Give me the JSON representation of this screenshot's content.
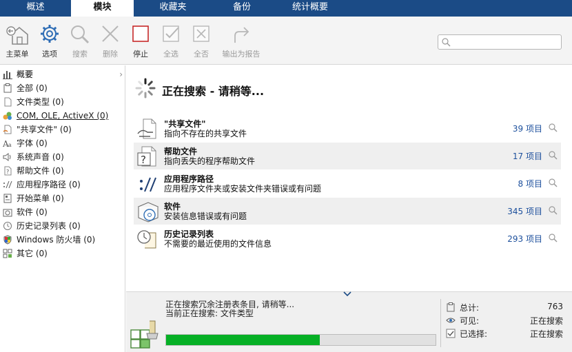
{
  "tabs": [
    {
      "label": "概述",
      "active": false
    },
    {
      "label": "模块",
      "active": true
    },
    {
      "label": "收藏夹",
      "active": false
    },
    {
      "label": "备份",
      "active": false
    },
    {
      "label": "统计概要",
      "active": false
    }
  ],
  "toolbar": {
    "buttons": [
      {
        "label": "主菜单",
        "icon": "home-back-icon",
        "enabled": true
      },
      {
        "label": "选项",
        "icon": "gear-icon",
        "enabled": true
      },
      {
        "label": "搜索",
        "icon": "magnifier-icon",
        "enabled": false
      },
      {
        "label": "删除",
        "icon": "delete-x-icon",
        "enabled": false
      },
      {
        "label": "停止",
        "icon": "stop-square-icon",
        "enabled": true
      },
      {
        "label": "全选",
        "icon": "check-all-icon",
        "enabled": false
      },
      {
        "label": "全否",
        "icon": "uncheck-all-icon",
        "enabled": false
      },
      {
        "label": "输出为报告",
        "icon": "export-report-icon",
        "enabled": false
      }
    ],
    "search_placeholder": "",
    "search_value": ""
  },
  "sidebar": {
    "items": [
      {
        "label": "概要",
        "icon": "bar-chart-icon",
        "selected": true
      },
      {
        "label": "全部 (0)",
        "icon": "clipboard-icon"
      },
      {
        "label": "文件类型 (0)",
        "icon": "file-types-icon"
      },
      {
        "label": "COM, OLE, ActiveX (0)",
        "icon": "com-cubes-icon",
        "underline": true
      },
      {
        "label": "\"共享文件\" (0)",
        "icon": "shared-file-icon"
      },
      {
        "label": "字体 (0)",
        "icon": "font-icon"
      },
      {
        "label": "系统声音 (0)",
        "icon": "speaker-icon"
      },
      {
        "label": "帮助文件 (0)",
        "icon": "help-file-icon"
      },
      {
        "label": "应用程序路径 (0)",
        "icon": "app-path-icon"
      },
      {
        "label": "开始菜单 (0)",
        "icon": "start-menu-icon"
      },
      {
        "label": "软件 (0)",
        "icon": "software-icon"
      },
      {
        "label": "历史记录列表 (0)",
        "icon": "history-icon"
      },
      {
        "label": "Windows 防火墙 (0)",
        "icon": "firewall-shield-icon"
      },
      {
        "label": "其它 (0)",
        "icon": "other-icon"
      }
    ]
  },
  "main": {
    "status_title": "正在搜索 - 请稍等...",
    "rows": [
      {
        "title": "\"共享文件\"",
        "desc": "指向不存在的共享文件",
        "count": "39 项目",
        "icon": "shared-file-icon"
      },
      {
        "title": "帮助文件",
        "desc": "指向丢失的程序帮助文件",
        "count": "17 项目",
        "icon": "help-file-icon"
      },
      {
        "title": "应用程序路径",
        "desc": "应用程序文件夹或安装文件夹错误或有问题",
        "count": "8 项目",
        "icon": "app-path-icon"
      },
      {
        "title": "软件",
        "desc": "安装信息错误或有问题",
        "count": "345 项目",
        "icon": "software-icon"
      },
      {
        "title": "历史记录列表",
        "desc": "不需要的最近使用的文件信息",
        "count": "293 项目",
        "icon": "history-icon"
      }
    ]
  },
  "bottom": {
    "line1": "正在搜索冗余注册表条目, 请稍等...",
    "line2": "当前正在搜索: 文件类型",
    "progress": 0.57,
    "progress_color": "#06b025",
    "stats": [
      {
        "label": "总计:",
        "value": "763",
        "icon": "clipboard-icon"
      },
      {
        "label": "可见:",
        "value": "正在搜索",
        "icon": "eye-icon"
      },
      {
        "label": "已选择:",
        "value": "正在搜索",
        "icon": "checkbox-icon"
      }
    ]
  },
  "colors": {
    "tabbar": "#1b4b86",
    "accent_blue": "#1c4f9c",
    "alt_row": "#efefef",
    "stop_red": "#c62828"
  }
}
